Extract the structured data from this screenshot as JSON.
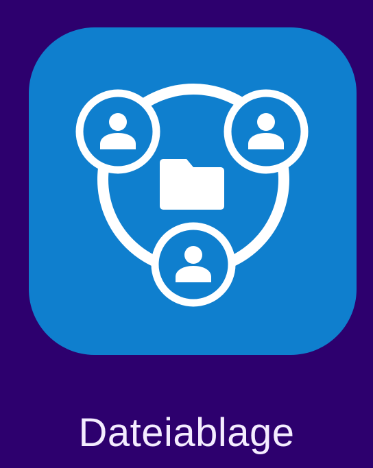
{
  "app": {
    "label": "Dateiablage",
    "icon": "shared-folder-network-icon"
  },
  "colors": {
    "background": "#2d006e",
    "tile": "#0f7fce",
    "glyph": "#ffffff",
    "label": "#f4ecff"
  }
}
